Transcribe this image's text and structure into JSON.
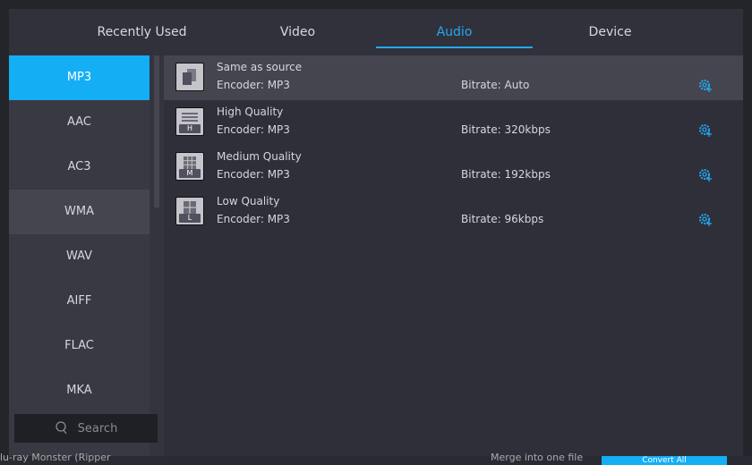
{
  "tabs": [
    {
      "label": "Recently Used"
    },
    {
      "label": "Video"
    },
    {
      "label": "Audio",
      "active": true
    },
    {
      "label": "Device"
    }
  ],
  "formats": [
    "MP3",
    "AAC",
    "AC3",
    "WMA",
    "WAV",
    "AIFF",
    "FLAC",
    "MKA"
  ],
  "selected_format": "MP3",
  "search": {
    "placeholder": "Search"
  },
  "profiles": [
    {
      "name": "Same as source",
      "encoder": "Encoder: MP3",
      "bitrate": "Bitrate: Auto",
      "badge": ""
    },
    {
      "name": "High Quality",
      "encoder": "Encoder: MP3",
      "bitrate": "Bitrate: 320kbps",
      "badge": "H"
    },
    {
      "name": "Medium Quality",
      "encoder": "Encoder: MP3",
      "bitrate": "Bitrate: 192kbps",
      "badge": "M"
    },
    {
      "name": "Low Quality",
      "encoder": "Encoder: MP3",
      "bitrate": "Bitrate: 96kbps",
      "badge": "L"
    }
  ],
  "background": {
    "output_label": "lu-ray Monster (Ripper",
    "merge_label": "Merge into one file",
    "convert_label": "Convert All"
  },
  "colors": {
    "accent": "#14aef4",
    "gear": "#22aaf0"
  }
}
